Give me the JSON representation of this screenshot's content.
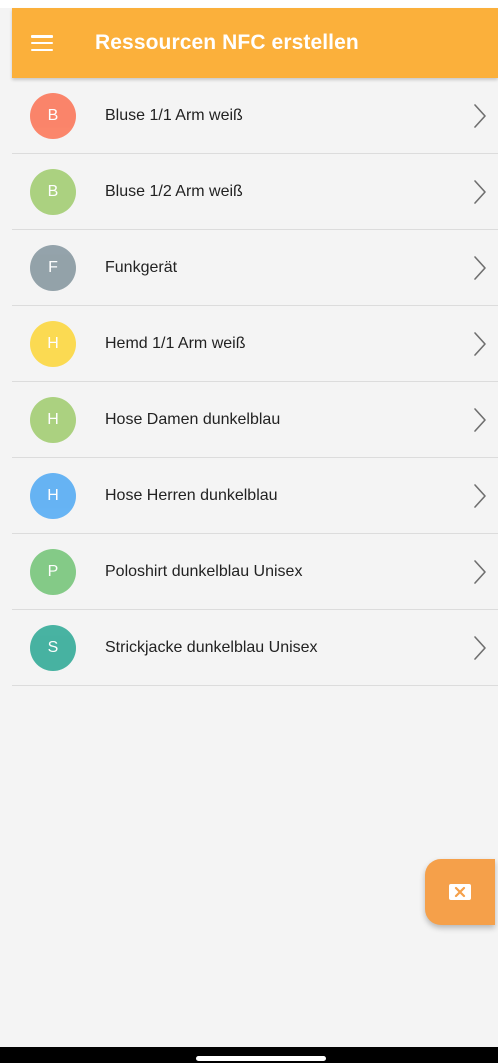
{
  "appbar": {
    "title": "Ressourcen NFC erstellen",
    "menu_icon": "hamburger-menu-icon",
    "color": "#fbb03b"
  },
  "items": [
    {
      "initial": "B",
      "label": "Bluse 1/1 Arm weiß",
      "color": "#fb7f63"
    },
    {
      "initial": "B",
      "label": "Bluse 1/2 Arm weiß",
      "color": "#a8d07a"
    },
    {
      "initial": "F",
      "label": "Funkgerät",
      "color": "#8e9ea6"
    },
    {
      "initial": "H",
      "label": "Hemd 1/1 Arm weiß",
      "color": "#fcd94a"
    },
    {
      "initial": "H",
      "label": "Hose Damen dunkelblau",
      "color": "#a8d07a"
    },
    {
      "initial": "H",
      "label": "Hose Herren dunkelblau",
      "color": "#5fb0f3"
    },
    {
      "initial": "P",
      "label": "Poloshirt dunkelblau Unisex",
      "color": "#7fc882"
    },
    {
      "initial": "S",
      "label": "Strickjacke dunkelblau Unisex",
      "color": "#3eaf9d"
    }
  ],
  "item_icon": "chevron-right-icon",
  "fab": {
    "icon": "backspace-close-icon",
    "color": "#f5a04a"
  }
}
